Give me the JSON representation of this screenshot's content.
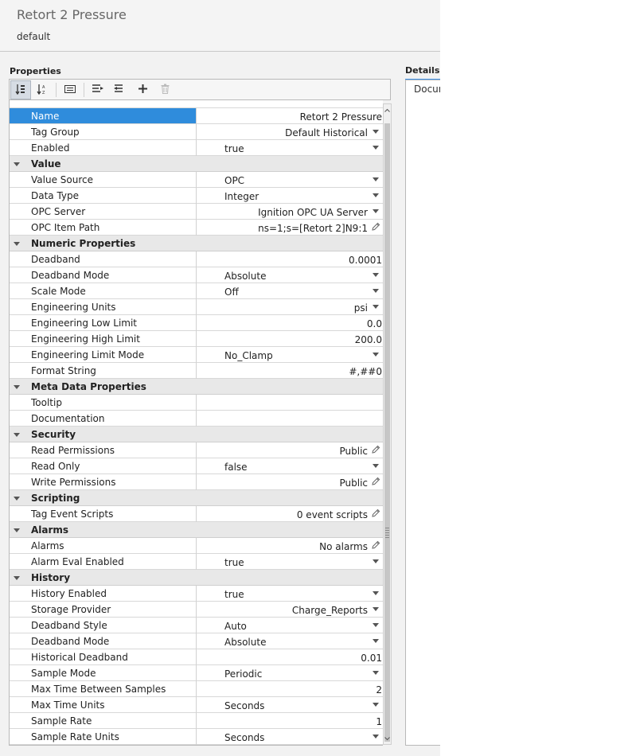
{
  "header": {
    "title": "Retort 2 Pressure",
    "subtitle": "default"
  },
  "properties": {
    "label": "Properties"
  },
  "details": {
    "label": "Details",
    "text": "Documentation"
  },
  "toolbar": {
    "buttons": [
      {
        "icon": "sort-category-icon",
        "active": true
      },
      {
        "icon": "sort-alpha-icon",
        "active": false
      },
      {
        "icon": "description-icon",
        "active": false
      },
      {
        "icon": "expand-all-icon",
        "active": false
      },
      {
        "icon": "collapse-all-icon",
        "active": false
      },
      {
        "icon": "add-icon",
        "active": false
      },
      {
        "icon": "delete-icon",
        "active": false
      }
    ]
  },
  "rows": [
    {
      "type": "prop",
      "label": "Name",
      "value": "Retort 2 Pressure",
      "align": "right",
      "selected": true
    },
    {
      "type": "prop",
      "label": "Tag Group",
      "value": "Default Historical",
      "align": "right",
      "icon": "dropdown"
    },
    {
      "type": "prop",
      "label": "Enabled",
      "value": "true",
      "align": "left",
      "icon": "dropdown"
    },
    {
      "type": "group",
      "label": "Value"
    },
    {
      "type": "prop",
      "label": "Value Source",
      "value": "OPC",
      "align": "left",
      "icon": "dropdown"
    },
    {
      "type": "prop",
      "label": "Data Type",
      "value": "Integer",
      "align": "left",
      "icon": "dropdown"
    },
    {
      "type": "prop",
      "label": "OPC Server",
      "value": "Ignition OPC UA Server",
      "align": "right",
      "icon": "dropdown"
    },
    {
      "type": "prop",
      "label": "OPC Item Path",
      "value": "ns=1;s=[Retort 2]N9:1",
      "align": "right",
      "icon": "edit"
    },
    {
      "type": "group",
      "label": "Numeric Properties"
    },
    {
      "type": "prop",
      "label": "Deadband",
      "value": "0.0001",
      "align": "right"
    },
    {
      "type": "prop",
      "label": "Deadband Mode",
      "value": "Absolute",
      "align": "left",
      "icon": "dropdown"
    },
    {
      "type": "prop",
      "label": "Scale Mode",
      "value": "Off",
      "align": "left",
      "icon": "dropdown"
    },
    {
      "type": "prop",
      "label": "Engineering Units",
      "value": "psi",
      "align": "right",
      "icon": "dropdown"
    },
    {
      "type": "prop",
      "label": "Engineering Low Limit",
      "value": "0.0",
      "align": "right"
    },
    {
      "type": "prop",
      "label": "Engineering High Limit",
      "value": "200.0",
      "align": "right"
    },
    {
      "type": "prop",
      "label": "Engineering Limit Mode",
      "value": "No_Clamp",
      "align": "left",
      "icon": "dropdown"
    },
    {
      "type": "prop",
      "label": "Format String",
      "value": "#,##0",
      "align": "right"
    },
    {
      "type": "group",
      "label": "Meta Data Properties"
    },
    {
      "type": "prop",
      "label": "Tooltip",
      "value": "",
      "align": "right"
    },
    {
      "type": "prop",
      "label": "Documentation",
      "value": "",
      "align": "right"
    },
    {
      "type": "group",
      "label": "Security"
    },
    {
      "type": "prop",
      "label": "Read Permissions",
      "value": "Public",
      "align": "right",
      "icon": "edit"
    },
    {
      "type": "prop",
      "label": "Read Only",
      "value": "false",
      "align": "left",
      "icon": "dropdown"
    },
    {
      "type": "prop",
      "label": "Write Permissions",
      "value": "Public",
      "align": "right",
      "icon": "edit"
    },
    {
      "type": "group",
      "label": "Scripting"
    },
    {
      "type": "prop",
      "label": "Tag Event Scripts",
      "value": "0 event scripts",
      "align": "right",
      "icon": "edit"
    },
    {
      "type": "group",
      "label": "Alarms"
    },
    {
      "type": "prop",
      "label": "Alarms",
      "value": "No alarms",
      "align": "right",
      "icon": "edit"
    },
    {
      "type": "prop",
      "label": "Alarm Eval Enabled",
      "value": "true",
      "align": "left",
      "icon": "dropdown"
    },
    {
      "type": "group",
      "label": "History"
    },
    {
      "type": "prop",
      "label": "History Enabled",
      "value": "true",
      "align": "left",
      "icon": "dropdown"
    },
    {
      "type": "prop",
      "label": "Storage Provider",
      "value": "Charge_Reports",
      "align": "right",
      "icon": "dropdown"
    },
    {
      "type": "prop",
      "label": "Deadband Style",
      "value": "Auto",
      "align": "left",
      "icon": "dropdown"
    },
    {
      "type": "prop",
      "label": "Deadband Mode",
      "value": "Absolute",
      "align": "left",
      "icon": "dropdown"
    },
    {
      "type": "prop",
      "label": "Historical Deadband",
      "value": "0.01",
      "align": "right"
    },
    {
      "type": "prop",
      "label": "Sample Mode",
      "value": "Periodic",
      "align": "left",
      "icon": "dropdown"
    },
    {
      "type": "prop",
      "label": "Max Time Between Samples",
      "value": "2",
      "align": "right"
    },
    {
      "type": "prop",
      "label": "Max Time Units",
      "value": "Seconds",
      "align": "left",
      "icon": "dropdown"
    },
    {
      "type": "prop",
      "label": "Sample Rate",
      "value": "1",
      "align": "right"
    },
    {
      "type": "prop",
      "label": "Sample Rate Units",
      "value": "Seconds",
      "align": "left",
      "icon": "dropdown"
    }
  ]
}
